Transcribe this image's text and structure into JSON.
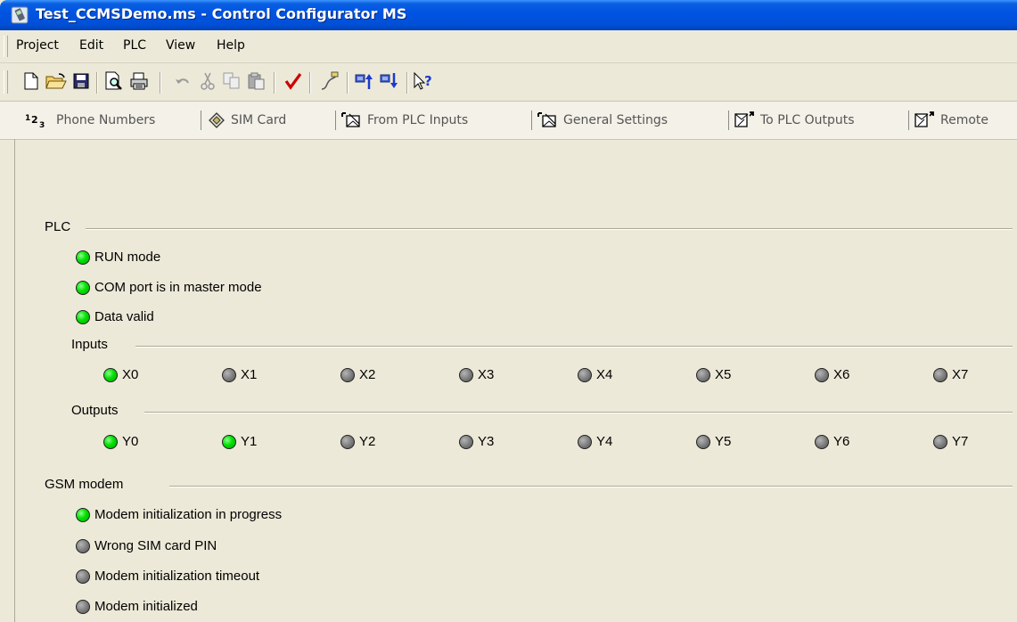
{
  "window": {
    "title": "Test_CCMSDemo.ms - Control Configurator MS"
  },
  "menu": [
    "Project",
    "Edit",
    "PLC",
    "View",
    "Help"
  ],
  "toolbar": [
    "new-file-icon",
    "open-folder-icon",
    "save-icon",
    "print-preview-icon",
    "print-icon",
    "undo-icon",
    "cut-icon",
    "copy-icon",
    "paste-icon",
    "check-icon",
    "connect-icon",
    "upload-icon",
    "download-icon",
    "context-help-icon"
  ],
  "tabs": [
    {
      "label": "Phone Numbers"
    },
    {
      "label": "SIM Card"
    },
    {
      "label": "From PLC Inputs"
    },
    {
      "label": "General Settings"
    },
    {
      "label": "To PLC Outputs"
    },
    {
      "label": "Remote"
    }
  ],
  "plc": {
    "group_label": "PLC",
    "status": [
      {
        "label": "RUN mode",
        "on": true
      },
      {
        "label": "COM port is in master mode",
        "on": true
      },
      {
        "label": "Data valid",
        "on": true
      }
    ],
    "inputs_label": "Inputs",
    "inputs": [
      {
        "label": "X0",
        "on": true
      },
      {
        "label": "X1",
        "on": false
      },
      {
        "label": "X2",
        "on": false
      },
      {
        "label": "X3",
        "on": false
      },
      {
        "label": "X4",
        "on": false
      },
      {
        "label": "X5",
        "on": false
      },
      {
        "label": "X6",
        "on": false
      },
      {
        "label": "X7",
        "on": false
      }
    ],
    "outputs_label": "Outputs",
    "outputs": [
      {
        "label": "Y0",
        "on": true
      },
      {
        "label": "Y1",
        "on": true
      },
      {
        "label": "Y2",
        "on": false
      },
      {
        "label": "Y3",
        "on": false
      },
      {
        "label": "Y4",
        "on": false
      },
      {
        "label": "Y5",
        "on": false
      },
      {
        "label": "Y6",
        "on": false
      },
      {
        "label": "Y7",
        "on": false
      }
    ]
  },
  "gsm": {
    "group_label": "GSM modem",
    "status": [
      {
        "label": "Modem initialization in progress",
        "on": true
      },
      {
        "label": "Wrong SIM card PIN",
        "on": false
      },
      {
        "label": "Modem initialization timeout",
        "on": false
      },
      {
        "label": "Modem initialized",
        "on": false
      }
    ]
  },
  "colors": {
    "led_on": "#00e000",
    "led_off": "#7a7a7a",
    "titlebar": "#0054e3"
  }
}
